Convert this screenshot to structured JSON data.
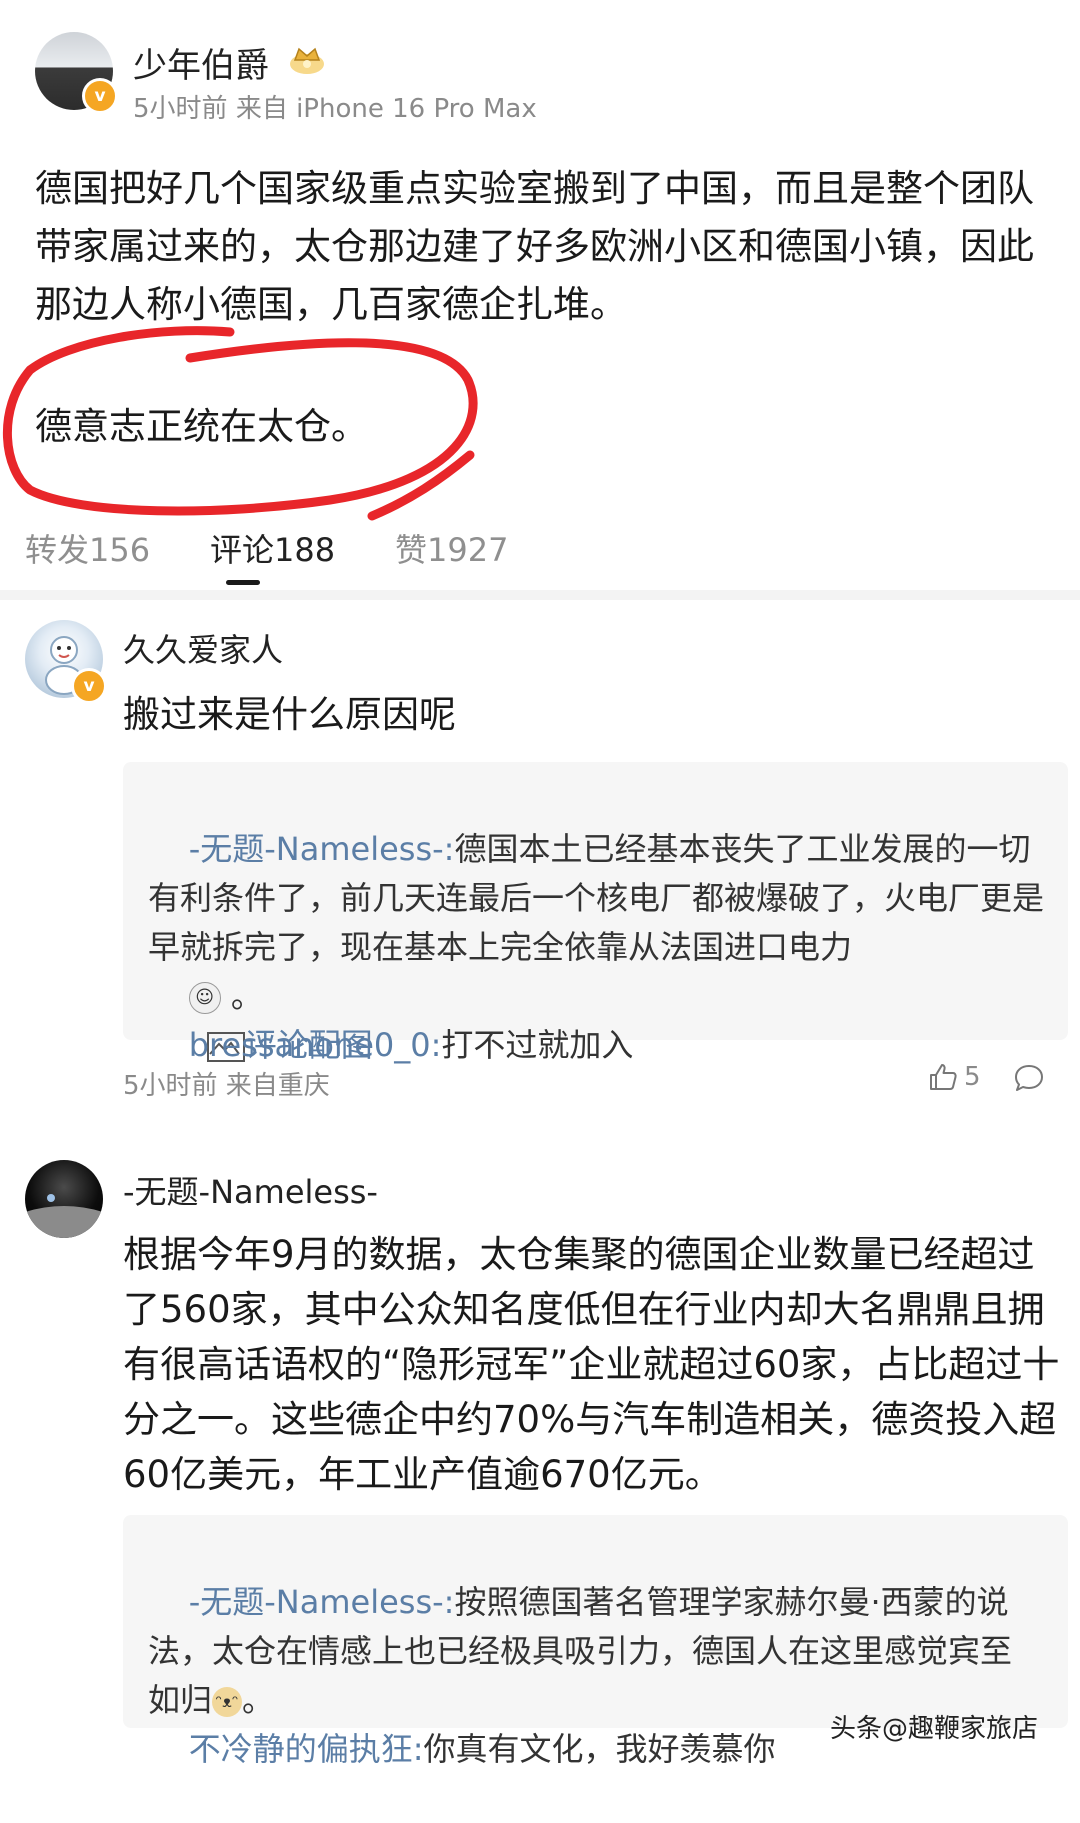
{
  "post": {
    "author": "少年伯爵",
    "time": "5小时前",
    "source": "来自 iPhone 16 Pro Max",
    "body": "德国把好几个国家级重点实验室搬到了中国，而且是整个团队带家属过来的，太仓那边建了好多欧洲小区和德国小镇，因此那边人称小德国，几百家德企扎堆。",
    "emphasis": "德意志正统在太仓。"
  },
  "tabs": [
    {
      "label": "转发156"
    },
    {
      "label": "评论188"
    },
    {
      "label": "赞1927"
    }
  ],
  "comments": [
    {
      "author": "久久爱家人",
      "text": "搬过来是什么原因呢",
      "replies": [
        {
          "user": "-无题-Nameless-:",
          "text": "德国本土已经基本丧失了工业发展的一切有利条件了，前几天连最后一个核电厂都被爆破了，火电厂更是早就拆完了，现在基本上完全依靠从法国进口电力"
        },
        {
          "user": "bressanone0_0:",
          "text": "打不过就加入"
        }
      ],
      "image_label": "评论配图",
      "meta": "5小时前 来自重庆",
      "likes": "5"
    },
    {
      "author": "-无题-Nameless-",
      "text": "根据今年9月的数据，太仓集聚的德国企业数量已经超过了560家，其中公众知名度低但在行业内却大名鼎鼎且拥有很高话语权的“隐形冠军”企业就超过60家，占比超过十分之一。这些德企中约70%与汽车制造相关，德资投入超60亿美元，年工业产值逾670亿元。",
      "replies": [
        {
          "user": "-无题-Nameless-:",
          "text": "按照德国著名管理学家赫尔曼·西蒙的说法，太仓在情感上也已经极具吸引力，德国人在这里感觉宾至如归"
        },
        {
          "user": "不冷静的偏执狂:",
          "text": "你真有文化，我好羡慕你"
        }
      ]
    }
  ],
  "watermark": "头条@趣鞭家旅店",
  "colors": {
    "annotation": "#e8262a",
    "verified": "#f5a623",
    "link_user": "#5b7ea6"
  }
}
